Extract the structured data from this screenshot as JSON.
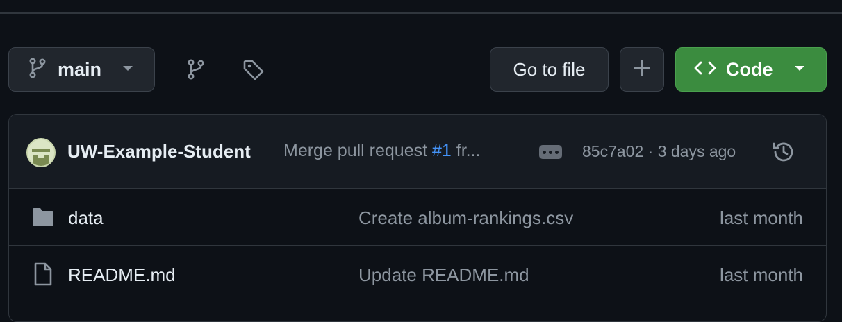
{
  "toolbar": {
    "branch_name": "main",
    "goto_file_label": "Go to file",
    "code_label": "Code"
  },
  "latest_commit": {
    "author": "UW-Example-Student",
    "message_prefix": "Merge pull request ",
    "pr_ref": "#1",
    "message_suffix": " fr...",
    "sha_and_time": "85c7a02 · 3 days ago"
  },
  "files": [
    {
      "name": "data",
      "type": "folder",
      "icon": "folder-icon",
      "message": "Create album-rankings.csv",
      "date": "last month"
    },
    {
      "name": "README.md",
      "type": "file",
      "icon": "file-icon",
      "message": "Update README.md",
      "date": "last month"
    }
  ],
  "colors": {
    "background": "#0d1117",
    "code_button": "#3b8c3f",
    "link": "#4493f8"
  }
}
